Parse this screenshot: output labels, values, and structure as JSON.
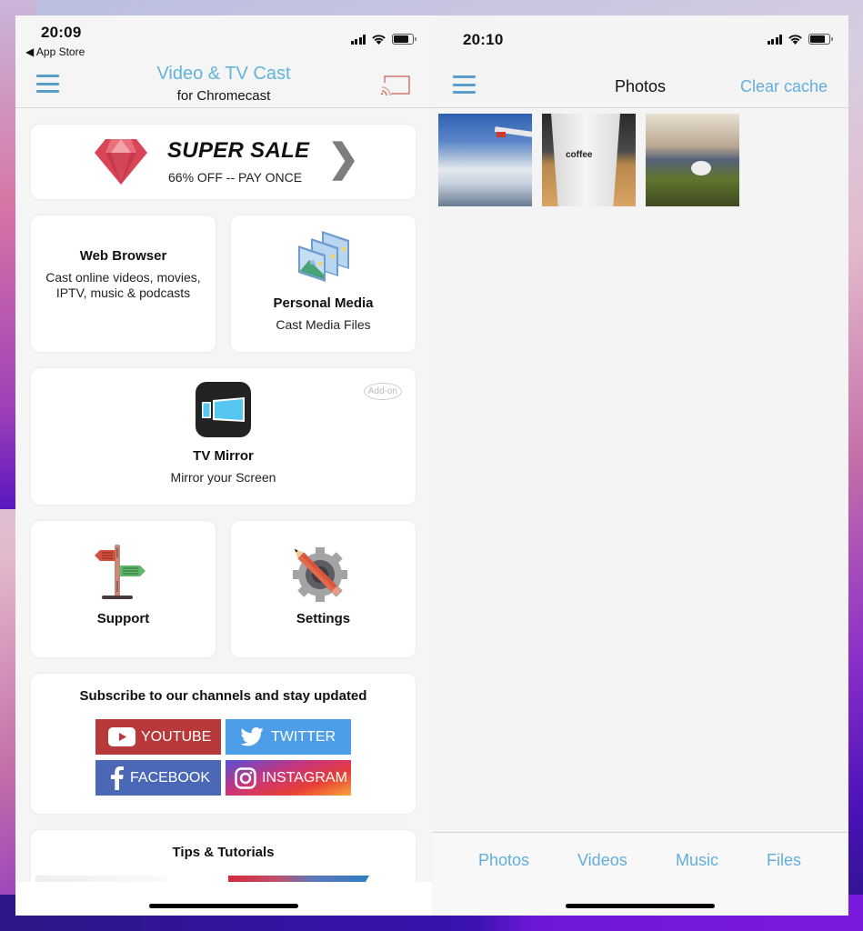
{
  "left_screen": {
    "status_bar": {
      "time": "20:09",
      "back_app": "◀ App Store"
    },
    "header": {
      "title": "Video & TV Cast",
      "subtitle": "for Chromecast",
      "menu_icon": "hamburger-icon",
      "cast_icon": "cast-icon"
    },
    "sale_banner": {
      "title": "SUPER SALE",
      "subtitle": "66% OFF -- PAY ONCE",
      "chevron": "❯",
      "icon": "diamond-icon"
    },
    "tiles": {
      "web_browser": {
        "title": "Web Browser",
        "subtitle": "Cast online videos, movies, IPTV, music & podcasts"
      },
      "personal_media": {
        "title": "Personal Media",
        "subtitle": "Cast Media Files",
        "icon": "photos-stack-icon"
      },
      "tv_mirror": {
        "title": "TV Mirror",
        "subtitle": "Mirror your Screen",
        "badge": "Add-on",
        "icon": "tv-mirror-icon"
      },
      "support": {
        "title": "Support",
        "icon": "signpost-icon"
      },
      "settings": {
        "title": "Settings",
        "icon": "gear-pencil-icon"
      }
    },
    "subscribe": {
      "heading": "Subscribe to our channels and stay updated",
      "buttons": [
        {
          "label": "YOUTUBE",
          "icon": "youtube-icon",
          "color": "#b8393a"
        },
        {
          "label": "TWITTER",
          "icon": "twitter-icon",
          "color": "#4c9ee8"
        },
        {
          "label": "FACEBOOK",
          "icon": "facebook-icon",
          "color": "#4a68b5"
        },
        {
          "label": "INSTAGRAM",
          "icon": "instagram-icon",
          "color": "#e73e37"
        }
      ]
    },
    "tips": {
      "heading": "Tips & Tutorials"
    }
  },
  "right_screen": {
    "status_bar": {
      "time": "20:10"
    },
    "header": {
      "title": "Photos",
      "action": "Clear cache",
      "menu_icon": "hamburger-icon"
    },
    "thumbnails": [
      {
        "description": "Aerial view of snowy mountains from airplane window"
      },
      {
        "description": "Coffee cup",
        "text": "coffee"
      },
      {
        "description": "Dog under green blanket on sofa"
      }
    ],
    "tabs": [
      "Photos",
      "Videos",
      "Music",
      "Files"
    ]
  },
  "colors": {
    "accent": "#62aedb",
    "title_blue": "#62b4da",
    "menu_blue": "#5b9ec9"
  }
}
